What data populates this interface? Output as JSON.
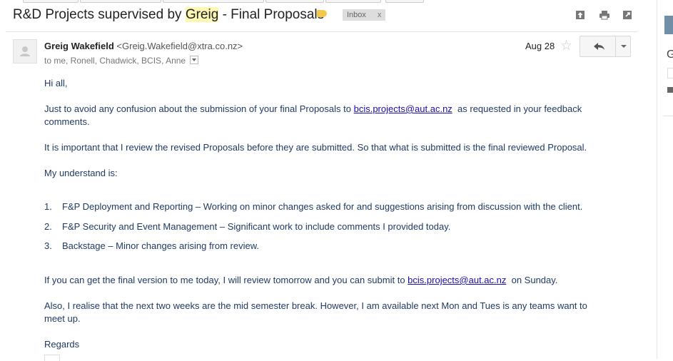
{
  "message": {
    "subject_before": "R&D Projects supervised by ",
    "subject_highlight": "Greig",
    "subject_after": " - Final Proposals",
    "label_chip": "Inbox",
    "label_chip_close": "x",
    "sender_name": "Greig Wakefield",
    "sender_email": "<Greig.Wakefield@xtra.co.nz>",
    "recipients": "to me, Ronell, Chadwick, BCIS, Anne",
    "date": "Aug 28",
    "star_glyph": "☆"
  },
  "body": {
    "greeting": "Hi all,",
    "p1_before": "Just to avoid any confusion about the submission of your final Proposals to ",
    "p1_link": "bcis.projects@aut.ac.nz",
    "p1_line1_after": "  as requested in your feedback",
    "p1_line2": "comments.",
    "p2": "It is important that I review the revised Proposals before they are submitted. So that what is submitted is the final reviewed Proposal.",
    "p3": "My understand is:",
    "list": [
      {
        "num": "1.",
        "text": "F&P Deployment and Reporting – Working on minor changes asked for and suggestions arising from discussion with the client."
      },
      {
        "num": "2.",
        "text": "F&P Security and Event Management – Significant work to include comments I provided today."
      },
      {
        "num": "3.",
        "text": "Backstage – Minor changes arising from review."
      }
    ],
    "p4_before": "If you can get the final version to me today, I will review tomorrow and you can submit to ",
    "p4_link": "bcis.projects@aut.ac.nz",
    "p4_after": "  on Sunday.",
    "p5_line1": "Also, I realise that the next two weeks are the mid semester break. However, I am available next Mon and Tues is any teams want to",
    "p5_line2": "meet up.",
    "closing": "Regards"
  },
  "sidepanel": {
    "letter": "G"
  },
  "colors": {
    "label_tag": "#f2c94c",
    "highlight": "#fcf8b3",
    "body_text": "#1f3a63",
    "link": "#1a0dab"
  },
  "icons": [
    "archive-icon",
    "print-icon",
    "new-window-icon",
    "reply-icon",
    "star-icon",
    "person-icon"
  ]
}
